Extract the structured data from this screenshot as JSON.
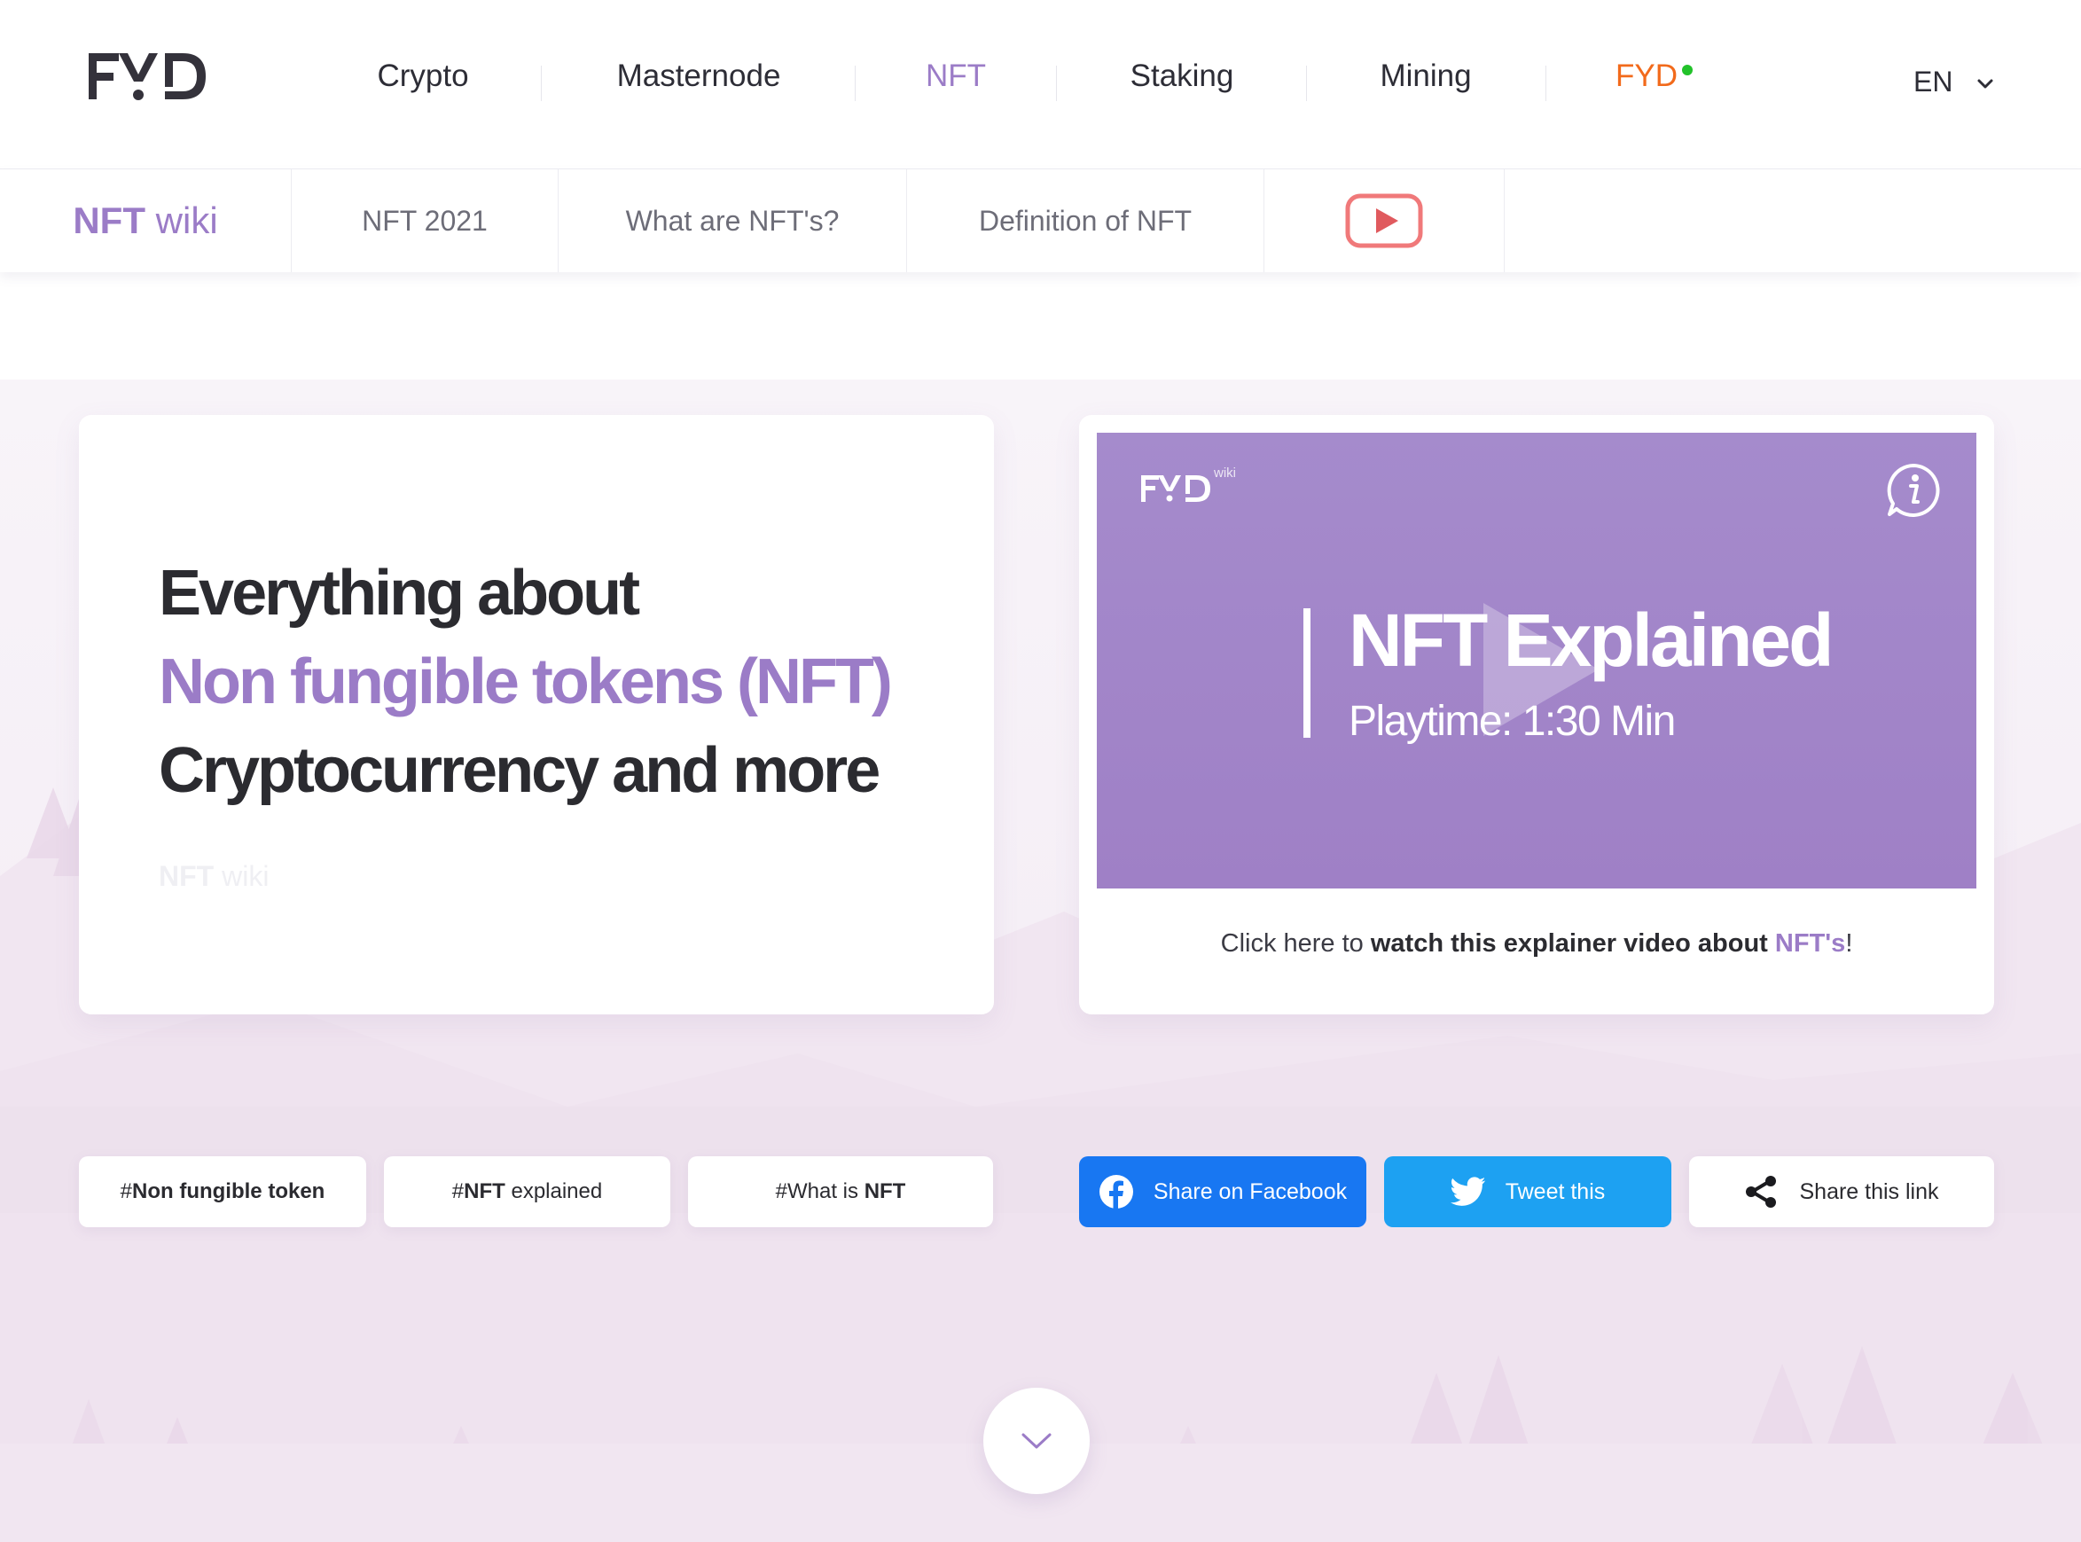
{
  "header": {
    "logo_text": "FYD",
    "nav": [
      {
        "label": "Crypto"
      },
      {
        "label": "Masternode"
      },
      {
        "label": "NFT"
      },
      {
        "label": "Staking"
      },
      {
        "label": "Mining"
      },
      {
        "label": "FYD"
      }
    ],
    "active_item": "NFT",
    "language": "EN"
  },
  "subnav": {
    "title_bold": "NFT",
    "title_light": "wiki",
    "items": [
      {
        "label": "NFT 2021"
      },
      {
        "label": "What are NFT's?"
      },
      {
        "label": "Definition of NFT"
      }
    ],
    "video_icon": "youtube-icon"
  },
  "hero": {
    "line1": "Everything about",
    "line2": "Non fungible tokens (NFT)",
    "line3": "Cryptocurrency and more",
    "faint_bold": "NFT",
    "faint_light": "wiki"
  },
  "video": {
    "logo_text": "FYD",
    "logo_sup": "wiki",
    "title": "NFT Explained",
    "subtitle": "Playtime: 1:30 Min",
    "caption_pre": "Click here to ",
    "caption_bold": "watch this explainer video about ",
    "caption_accent": "NFT's",
    "caption_post": "!"
  },
  "tags": [
    {
      "hash": "#",
      "bold": "Non fungible token",
      "rest": ""
    },
    {
      "hash": "#",
      "bold": "NFT",
      "rest": " explained"
    },
    {
      "hash": "#",
      "pre": "What is ",
      "bold": "NFT"
    }
  ],
  "share": {
    "facebook": "Share on Facebook",
    "twitter": "Tweet this",
    "link": "Share this link"
  },
  "colors": {
    "accent": "#9b7cc7",
    "brand_orange": "#f26a1b",
    "online": "#22c22a",
    "facebook": "#1877f2",
    "twitter": "#1da1f2"
  }
}
